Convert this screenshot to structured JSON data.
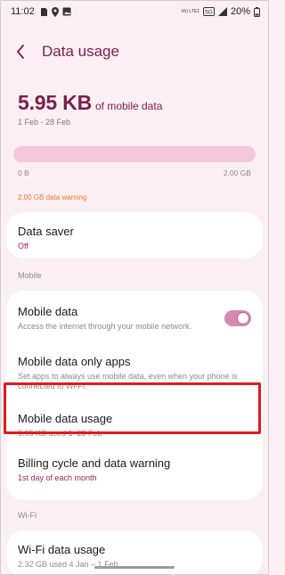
{
  "status_bar": {
    "time": "11:02",
    "network_label": "Vo) LTE1",
    "battery_percent": "20%",
    "icons": [
      "sim-icon",
      "location-icon",
      "gallery-icon",
      "5g-icon",
      "signal-icon",
      "battery-icon"
    ]
  },
  "header": {
    "title": "Data usage"
  },
  "usage": {
    "amount": "5.95 KB",
    "amount_suffix": "of mobile data",
    "period": "1 Feb - 28 Feb",
    "fill_fraction": 1e-05,
    "scale_min": "0 B",
    "scale_max": "2.00 GB",
    "warning": "2.00 GB data warning"
  },
  "data_saver": {
    "title": "Data saver",
    "value": "Off"
  },
  "mobile_section": {
    "label": "Mobile",
    "mobile_data": {
      "title": "Mobile data",
      "subtitle": "Access the internet through your mobile network.",
      "enabled": true
    },
    "only_apps": {
      "title": "Mobile data only apps",
      "subtitle": "Set apps to always use mobile data, even when your phone is connected to Wi-Fi."
    },
    "usage": {
      "title": "Mobile data usage",
      "subtitle": "5.95 KB used 1–28 Feb"
    },
    "billing": {
      "title": "Billing cycle and data warning",
      "subtitle": "1st day of each month"
    }
  },
  "wifi_section": {
    "label": "Wi-Fi",
    "usage": {
      "title": "Wi-Fi data usage",
      "subtitle": "2.32 GB used 4 Jan – 1 Feb"
    }
  },
  "colors": {
    "background": "#fbeff3",
    "accent": "#7a1f4b",
    "bar_track": "#f3c9da",
    "warning": "#e8772b",
    "highlight": "#e01c1c"
  }
}
